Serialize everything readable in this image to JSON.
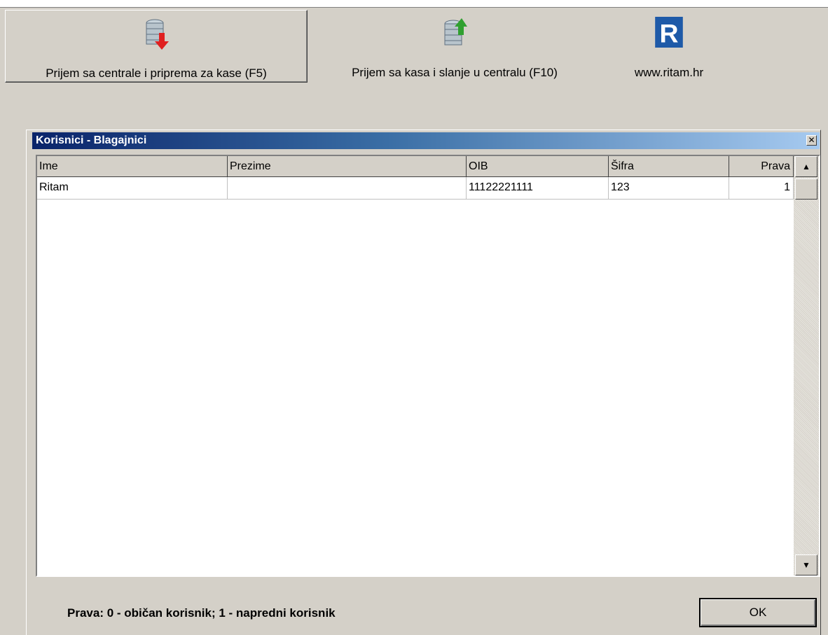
{
  "toolbar": {
    "buttons": [
      {
        "label": "Prijem sa centrale i priprema za kase (F5)",
        "icon": "database-download-icon"
      },
      {
        "label": "Prijem sa kasa i slanje u centralu (F10)",
        "icon": "database-upload-icon"
      },
      {
        "label": "www.ritam.hr",
        "icon": "ritam-logo-icon"
      }
    ],
    "logo_letter": "R"
  },
  "dialog": {
    "title": "Korisnici - Blagajnici",
    "close_glyph": "✕",
    "table": {
      "columns": [
        "Ime",
        "Prezime",
        "OIB",
        "Šifra",
        "Prava"
      ],
      "rows": [
        [
          "Ritam",
          "",
          "11122221111",
          "123",
          "1"
        ]
      ]
    },
    "legend": "Prava: 0 - običan korisnik; 1 - napredni korisnik",
    "ok_label": "OK"
  },
  "colors": {
    "title_gradient_start": "#0a246a",
    "title_gradient_end": "#a6caf0",
    "download_arrow": "#e02020",
    "upload_arrow": "#30a030",
    "logo_bg": "#1e5aa8"
  }
}
